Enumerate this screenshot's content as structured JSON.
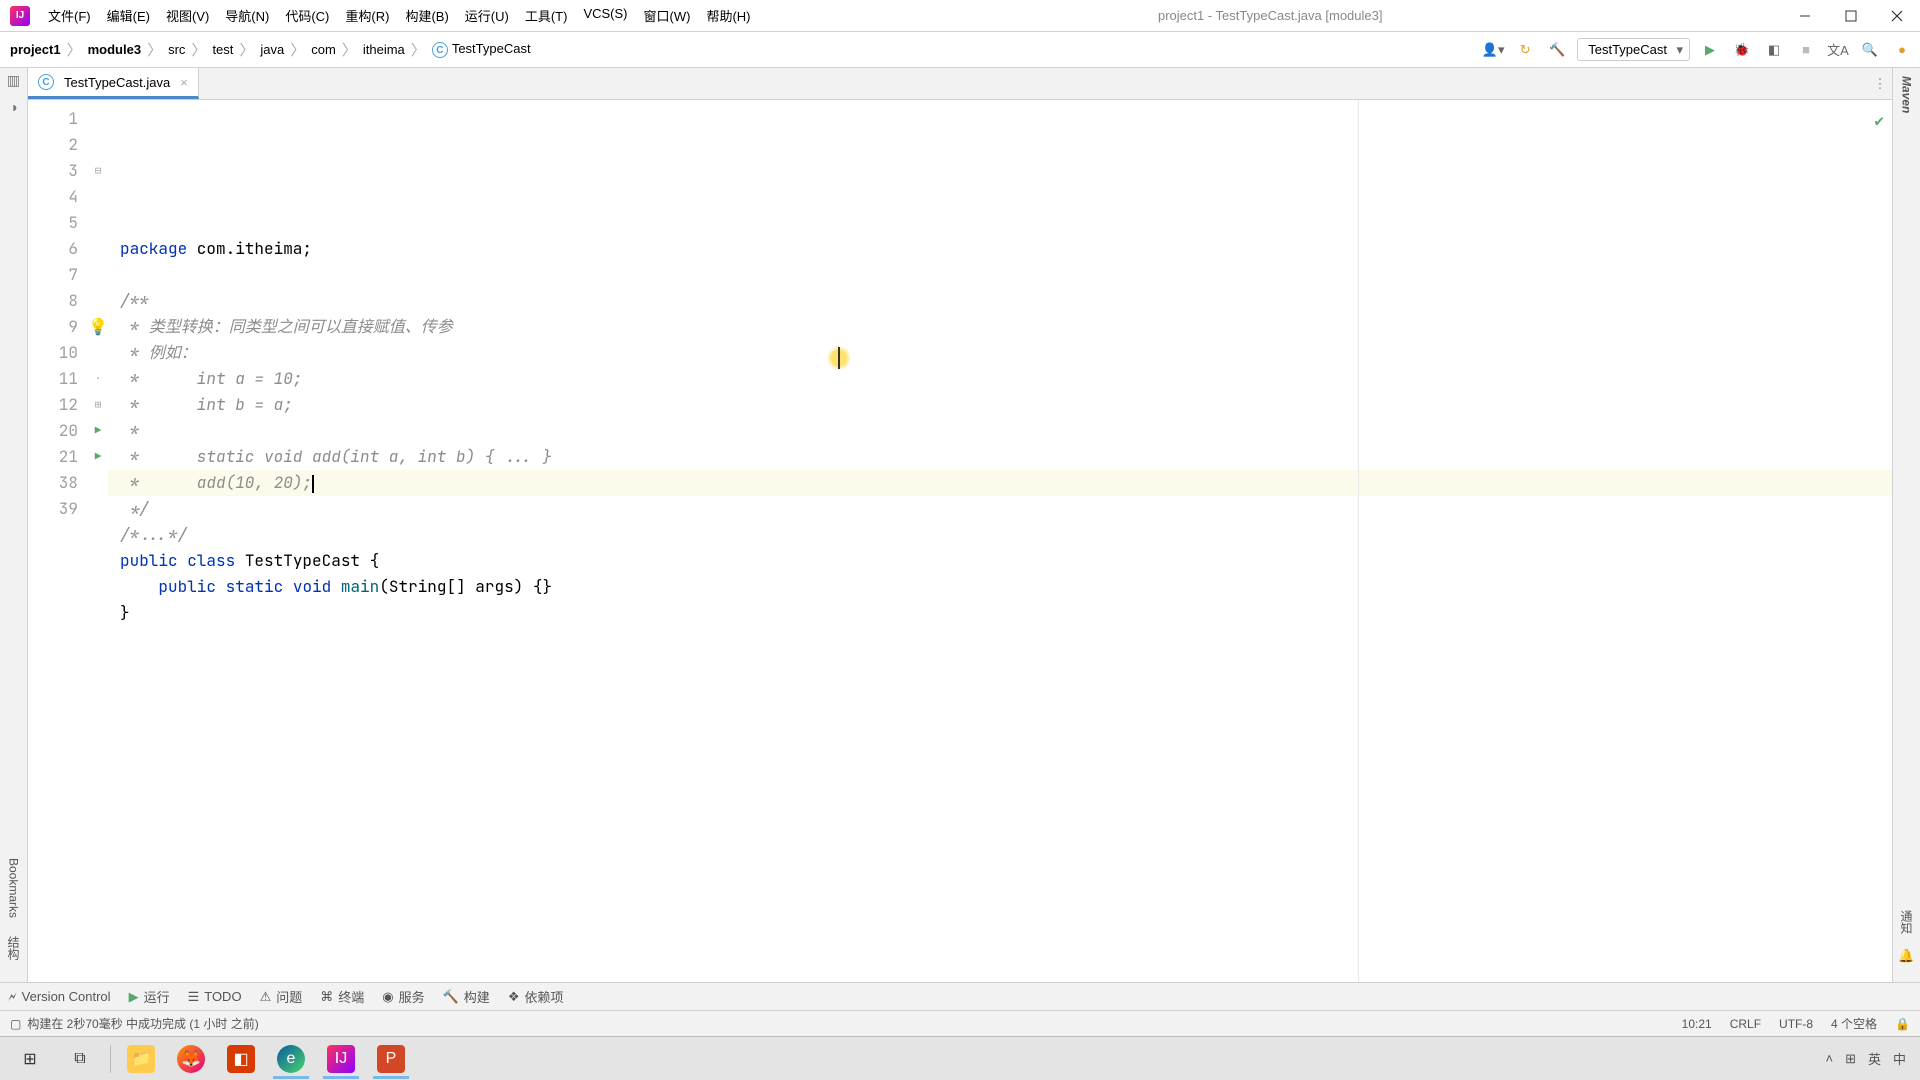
{
  "title": "project1 - TestTypeCast.java [module3]",
  "menu": {
    "file": "文件(F)",
    "edit": "编辑(E)",
    "view": "视图(V)",
    "nav": "导航(N)",
    "code": "代码(C)",
    "refactor": "重构(R)",
    "build": "构建(B)",
    "run": "运行(U)",
    "tools": "工具(T)",
    "vcs": "VCS(S)",
    "window": "窗口(W)",
    "help": "帮助(H)"
  },
  "breadcrumbs": [
    "project1",
    "module3",
    "src",
    "test",
    "java",
    "com",
    "itheima",
    "TestTypeCast"
  ],
  "run_config": "TestTypeCast",
  "tab": {
    "name": "TestTypeCast.java"
  },
  "left_tools": {
    "bookmarks": "Bookmarks",
    "structure": "结构"
  },
  "right_tools": {
    "maven": "Maven",
    "notify": "通知"
  },
  "code_lines": [
    {
      "n": 1,
      "html": "<span class='kw'>package</span> com.itheima;"
    },
    {
      "n": 2,
      "html": ""
    },
    {
      "n": 3,
      "html": "<span class='com'>/**</span>",
      "fold": "⊟"
    },
    {
      "n": 4,
      "html": "<span class='com'> * 类型转换：同类型之间可以直接赋值、传参</span>"
    },
    {
      "n": 5,
      "html": "<span class='com'> * 例如：</span>"
    },
    {
      "n": 6,
      "html": "<span class='com'> *      int a = 10;</span>"
    },
    {
      "n": 7,
      "html": "<span class='com'> *      int b = a;</span>"
    },
    {
      "n": 8,
      "html": "<span class='com'> *</span>"
    },
    {
      "n": 9,
      "html": "<span class='com'> *      static void add(int a, int b) { ... }</span>",
      "bulb": true
    },
    {
      "n": 10,
      "html": "<span class='com'> *      add(10, 20);</span>",
      "hl": true,
      "caret": 210
    },
    {
      "n": 11,
      "html": "<span class='com'> */</span>",
      "fold": "·"
    },
    {
      "n": 12,
      "html": "<span class='com'>/*...*/</span>",
      "fold": "⊞"
    },
    {
      "n": 20,
      "html": "<span class='kw'>public</span> <span class='kw'>class</span> TestTypeCast {",
      "run": true,
      "fold": "⊟"
    },
    {
      "n": 21,
      "html": "    <span class='kw'>public</span> <span class='kw'>static</span> <span class='kw'>void</span> <span class='fn'>main</span>(String[] args) {}",
      "run": true,
      "fold": "⊞"
    },
    {
      "n": 38,
      "html": "}"
    },
    {
      "n": 39,
      "html": ""
    }
  ],
  "bottom_tools": {
    "vc": "Version Control",
    "run": "运行",
    "todo": "TODO",
    "problems": "问题",
    "terminal": "终端",
    "services": "服务",
    "build": "构建",
    "deps": "依赖项"
  },
  "status": {
    "msg": "构建在 2秒70毫秒 中成功完成 (1 小时 之前)",
    "pos": "10:21",
    "eol": "CRLF",
    "enc": "UTF-8",
    "indent": "4 个空格"
  },
  "tray": {
    "ime1": "英",
    "ime2": "中"
  }
}
